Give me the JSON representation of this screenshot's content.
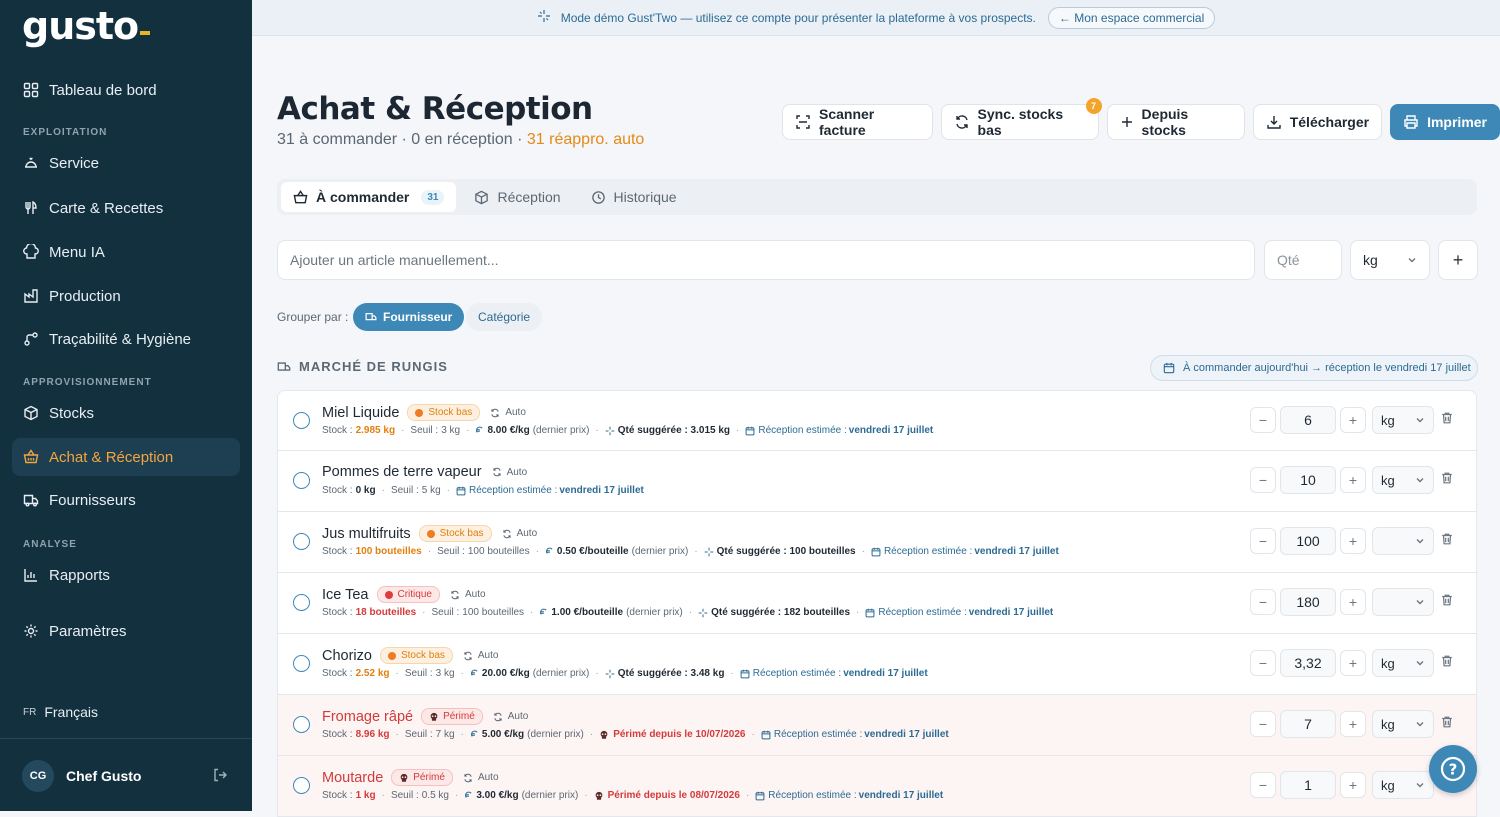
{
  "sidebar": {
    "logo": "gusto",
    "items": [
      {
        "label": "Tableau de bord",
        "icon": "dashboard-icon"
      },
      {
        "label": "Service",
        "icon": "cloche-icon"
      },
      {
        "label": "Carte & Recettes",
        "icon": "utensils-icon"
      },
      {
        "label": "Menu IA",
        "icon": "chef-hat-icon"
      },
      {
        "label": "Production",
        "icon": "production-icon"
      },
      {
        "label": "Traçabilité & Hygiène",
        "icon": "trace-icon"
      },
      {
        "label": "Stocks",
        "icon": "box-icon"
      },
      {
        "label": "Achat & Réception",
        "icon": "basket-icon",
        "active": true
      },
      {
        "label": "Fournisseurs",
        "icon": "truck-icon"
      },
      {
        "label": "Rapports",
        "icon": "chart-icon"
      },
      {
        "label": "Paramètres",
        "icon": "gear-icon"
      }
    ],
    "sections": [
      "EXPLOITATION",
      "APPROVISIONNEMENT",
      "ANALYSE"
    ],
    "lang_code": "FR",
    "lang_label": "Français",
    "user_initials": "CG",
    "user_name": "Chef Gusto"
  },
  "banner": {
    "text": "Mode démo Gust'Two — utilisez ce compte pour présenter la plateforme à vos prospects.",
    "button": "← Mon espace commercial"
  },
  "header": {
    "title": "Achat & Réception",
    "sub_a": "31 à commander · 0 en réception · ",
    "sub_b": "31 réappro. auto"
  },
  "actions": {
    "scan": "Scanner facture",
    "sync": "Sync. stocks bas",
    "sync_badge": "7",
    "from_stock": "Depuis stocks",
    "download": "Télécharger",
    "print": "Imprimer"
  },
  "tabs": {
    "order": "À commander",
    "order_count": "31",
    "reception": "Réception",
    "history": "Historique"
  },
  "add": {
    "placeholder": "Ajouter un article manuellement...",
    "qty_placeholder": "Qté",
    "unit": "kg",
    "plus": "+"
  },
  "group": {
    "label": "Grouper par :",
    "supplier": "Fournisseur",
    "category": "Catégorie"
  },
  "supplier_block": {
    "name": "MARCHÉ DE RUNGIS",
    "note": "À commander aujourd'hui → réception le vendredi 17 juillet"
  },
  "help_label": "?",
  "rows": [
    {
      "name": "Miel Liquide",
      "tag": "Stock bas",
      "tag_type": "low",
      "auto": "Auto",
      "stock": "2.985 kg",
      "stock_type": "warn",
      "seuil": "3 kg",
      "price": "8.00 €/kg",
      "price_note": "(dernier prix)",
      "sugg": "Qté suggérée : 3.015 kg",
      "rec": "Réception estimée : ",
      "rec_date": "vendredi 17 juillet",
      "qty": "6",
      "unit": "kg",
      "expired": false
    },
    {
      "name": "Pommes de terre vapeur",
      "tag": "",
      "tag_type": "",
      "auto": "Auto",
      "stock": "0 kg",
      "stock_type": "normal",
      "seuil": "5 kg",
      "price": "",
      "price_note": "",
      "sugg": "",
      "rec": "Réception estimée : ",
      "rec_date": "vendredi 17 juillet",
      "qty": "10",
      "unit": "kg",
      "expired": false
    },
    {
      "name": "Jus multifruits",
      "tag": "Stock bas",
      "tag_type": "low",
      "auto": "Auto",
      "stock": "100 bouteilles",
      "stock_type": "warn",
      "seuil": "100 bouteilles",
      "price": "0.50 €/bouteille",
      "price_note": "(dernier prix)",
      "sugg": "Qté suggérée : 100 bouteilles",
      "rec": "Réception estimée : ",
      "rec_date": "vendredi 17 juillet",
      "qty": "100",
      "unit": "",
      "expired": false
    },
    {
      "name": "Ice Tea",
      "tag": "Critique",
      "tag_type": "crit",
      "auto": "Auto",
      "stock": "18 bouteilles",
      "stock_type": "crit",
      "seuil": "100 bouteilles",
      "price": "1.00 €/bouteille",
      "price_note": "(dernier prix)",
      "sugg": "Qté suggérée : 182 bouteilles",
      "rec": "Réception estimée : ",
      "rec_date": "vendredi 17 juillet",
      "qty": "180",
      "unit": "",
      "expired": false
    },
    {
      "name": "Chorizo",
      "tag": "Stock bas",
      "tag_type": "low",
      "auto": "Auto",
      "stock": "2.52 kg",
      "stock_type": "warn",
      "seuil": "3 kg",
      "price": "20.00 €/kg",
      "price_note": "(dernier prix)",
      "sugg": "Qté suggérée : 3.48 kg",
      "rec": "Réception estimée : ",
      "rec_date": "vendredi 17 juillet",
      "qty": "3,32",
      "unit": "kg",
      "expired": false
    },
    {
      "name": "Fromage râpé",
      "tag": "Périmé",
      "tag_type": "exp",
      "auto": "Auto",
      "stock": "8.96 kg",
      "stock_type": "crit",
      "seuil": "7 kg",
      "price": "5.00 €/kg",
      "price_note": "(dernier prix)",
      "sugg": "Périmé depuis le 10/07/2026",
      "rec": "Réception estimée : ",
      "rec_date": "vendredi 17 juillet",
      "qty": "7",
      "unit": "kg",
      "expired": true
    },
    {
      "name": "Moutarde",
      "tag": "Périmé",
      "tag_type": "exp",
      "auto": "Auto",
      "stock": "1 kg",
      "stock_type": "crit",
      "seuil": "0.5 kg",
      "price": "3.00 €/kg",
      "price_note": "(dernier prix)",
      "sugg": "Périmé depuis le 08/07/2026",
      "rec": "Réception estimée : ",
      "rec_date": "vendredi 17 juillet",
      "qty": "1",
      "unit": "kg",
      "expired": true
    }
  ]
}
